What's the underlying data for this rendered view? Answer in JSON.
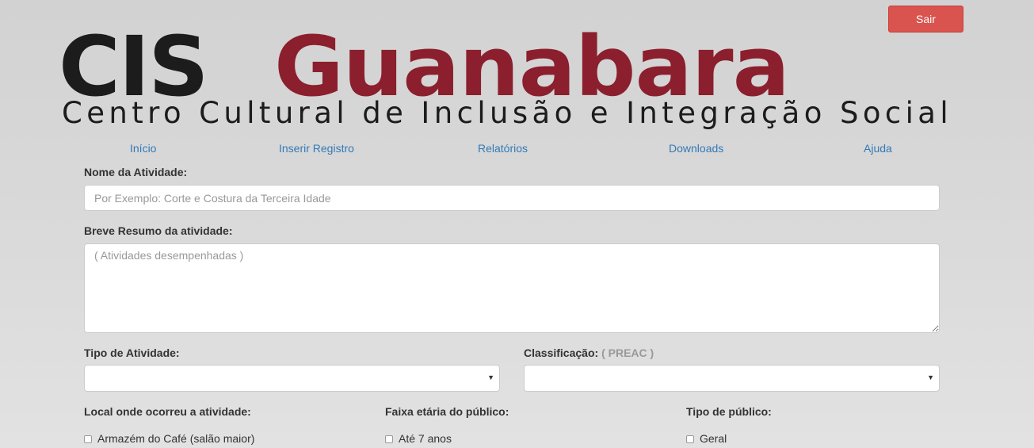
{
  "header": {
    "logout_label": "Sair"
  },
  "logo": {
    "part1": "CIS",
    "part2": "Guanabara",
    "subtitle": "Centro Cultural de Inclusão e Integração Social",
    "colors": {
      "dark": "#1c1c1c",
      "brand": "#8b1f2d"
    }
  },
  "nav": {
    "items": [
      {
        "label": "Início"
      },
      {
        "label": "Inserir Registro"
      },
      {
        "label": "Relatórios"
      },
      {
        "label": "Downloads"
      },
      {
        "label": "Ajuda"
      }
    ]
  },
  "form": {
    "activity_name": {
      "label": "Nome da Atividade:",
      "placeholder": "Por Exemplo: Corte e Costura da Terceira Idade",
      "value": ""
    },
    "summary": {
      "label": "Breve Resumo da atividade:",
      "placeholder": "( Atividades desempenhadas )",
      "value": ""
    },
    "activity_type": {
      "label": "Tipo de Atividade:",
      "selected": ""
    },
    "classification": {
      "label": "Classificação:",
      "hint": "( PREAC )",
      "selected": ""
    },
    "location": {
      "label": "Local onde ocorreu a atividade:",
      "options": [
        {
          "label": "Armazém do Café (salão maior)",
          "checked": false
        }
      ]
    },
    "age_range": {
      "label": "Faixa etária do público:",
      "options": [
        {
          "label": "Até 7 anos",
          "checked": false
        }
      ]
    },
    "audience_type": {
      "label": "Tipo de público:",
      "options": [
        {
          "label": "Geral",
          "checked": false
        }
      ]
    }
  },
  "colors": {
    "accent_link": "#337ab7",
    "danger_button": "#d9534f"
  }
}
